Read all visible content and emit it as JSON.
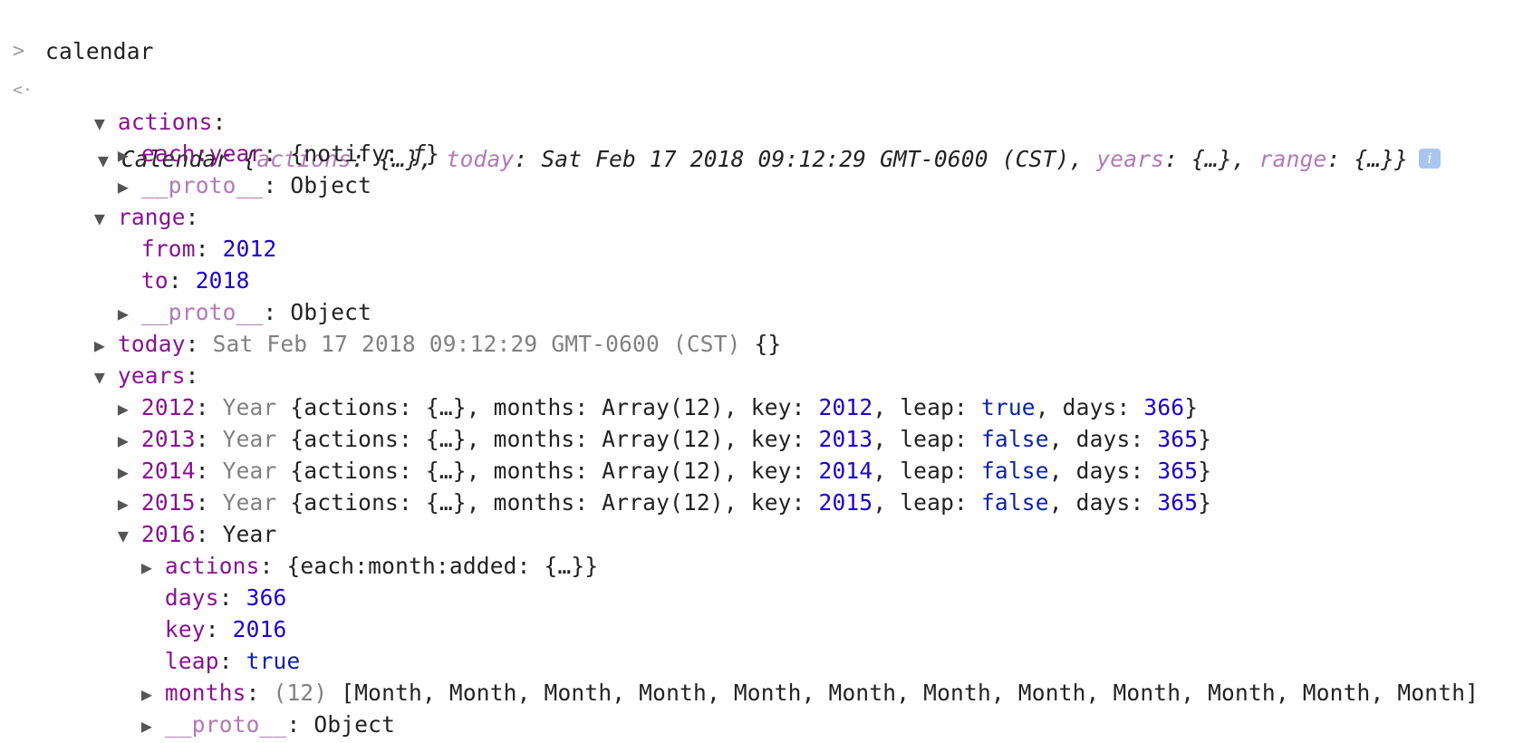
{
  "console": {
    "prompt_glyph": ">",
    "result_glyph": "<·",
    "input": "calendar"
  },
  "root": {
    "class": "Calendar",
    "open_brace": "{",
    "close_brace": "}",
    "summary_actions_key": "actions",
    "summary_actions_val": "{…}",
    "summary_today_key": "today",
    "summary_today_val": "Sat Feb 17 2018 09:12:29 GMT-0600 (CST)",
    "summary_years_key": "years",
    "summary_years_val": "{…}",
    "summary_range_key": "range",
    "summary_range_val": "{…}",
    "info_icon_glyph": "i"
  },
  "actions": {
    "key": "actions",
    "each_year_key": "each:year",
    "each_year_val_open": "{",
    "each_year_val_key": "notify",
    "each_year_val_fn": "ƒ",
    "each_year_val_close": "}",
    "proto_key": "__proto__",
    "proto_val": "Object"
  },
  "range": {
    "key": "range",
    "from_key": "from",
    "from_val": "2012",
    "to_key": "to",
    "to_val": "2018",
    "proto_key": "__proto__",
    "proto_val": "Object"
  },
  "today": {
    "key": "today",
    "val": "Sat Feb 17 2018 09:12:29 GMT-0600 (CST)",
    "suffix": "{}"
  },
  "years": {
    "key": "years",
    "collapsed": [
      {
        "key": "2012",
        "class": "Year",
        "actions_val": "{…}",
        "months_val": "Array(12)",
        "key_val": "2012",
        "leap_val": "true",
        "days_val": "366"
      },
      {
        "key": "2013",
        "class": "Year",
        "actions_val": "{…}",
        "months_val": "Array(12)",
        "key_val": "2013",
        "leap_val": "false",
        "days_val": "365"
      },
      {
        "key": "2014",
        "class": "Year",
        "actions_val": "{…}",
        "months_val": "Array(12)",
        "key_val": "2014",
        "leap_val": "false",
        "days_val": "365"
      },
      {
        "key": "2015",
        "class": "Year",
        "actions_val": "{…}",
        "months_val": "Array(12)",
        "key_val": "2015",
        "leap_val": "false",
        "days_val": "365"
      }
    ],
    "field_labels": {
      "actions": "actions",
      "months": "months",
      "key": "key",
      "leap": "leap",
      "days": "days"
    },
    "expanded": {
      "key": "2016",
      "class": "Year",
      "actions_key": "actions",
      "actions_val": "{each:month:added: {…}}",
      "days_key": "days",
      "days_val": "366",
      "key_key": "key",
      "key_val": "2016",
      "leap_key": "leap",
      "leap_val": "true",
      "months_key": "months",
      "months_count": "(12)",
      "months_val": "[Month, Month, Month, Month, Month, Month, Month, Month, Month, Month, Month, Month]",
      "partial_key": "__proto__",
      "partial_val": "Object"
    }
  }
}
